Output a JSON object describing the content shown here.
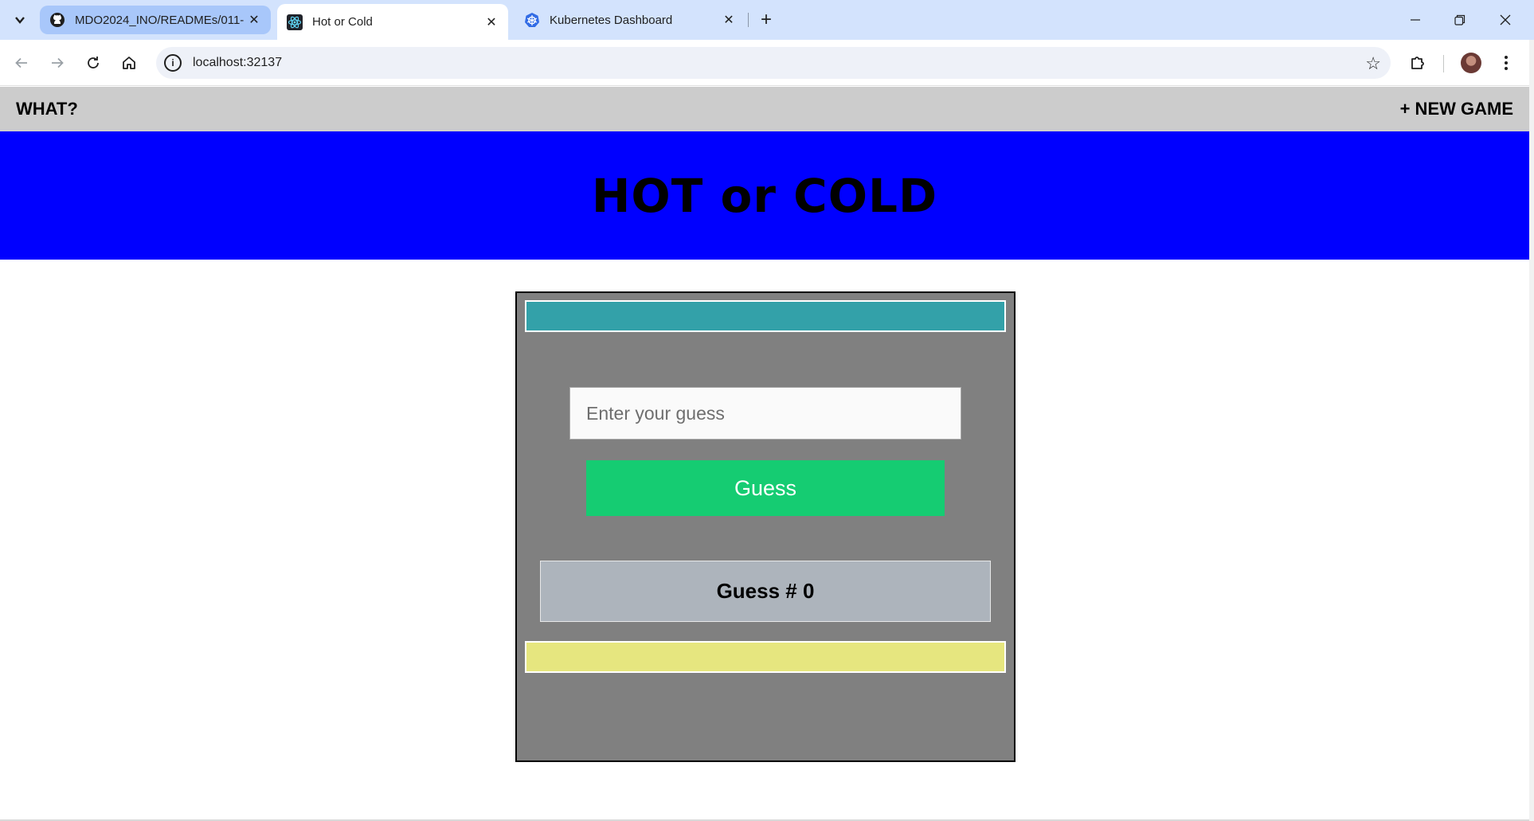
{
  "browser": {
    "tabs": [
      {
        "title": "MDO2024_INO/READMEs/011-",
        "icon": "github-icon",
        "state": "inactive-highlight"
      },
      {
        "title": "Hot or Cold",
        "icon": "react-icon",
        "state": "active"
      },
      {
        "title": "Kubernetes Dashboard",
        "icon": "kubernetes-icon",
        "state": "inactive"
      }
    ],
    "address": "localhost:32137",
    "accent_color": "#d3e3fd"
  },
  "app": {
    "nav_left": "WHAT?",
    "nav_right": "+ NEW GAME",
    "title": "HOT or COLD",
    "input_placeholder": "Enter your guess",
    "guess_button": "Guess",
    "guess_count_label": "Guess # 0",
    "colors": {
      "banner": "#0000ff",
      "feedback": "#33a1a9",
      "button": "#15cc72",
      "history": "#e6e67f",
      "panel": "#808080"
    }
  }
}
